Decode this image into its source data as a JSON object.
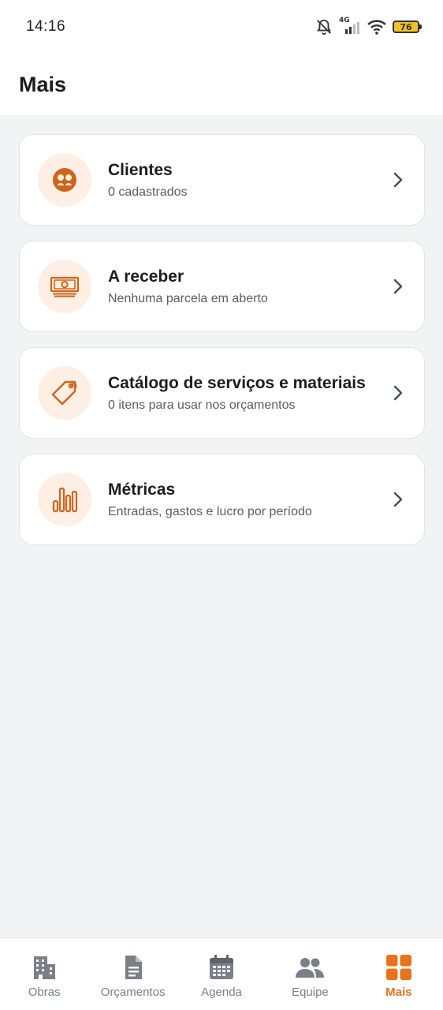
{
  "status_bar": {
    "time": "14:16",
    "network": "4G",
    "battery": "76"
  },
  "header": {
    "title": "Mais"
  },
  "menu": [
    {
      "title": "Clientes",
      "subtitle": "0 cadastrados",
      "icon": "clients-icon"
    },
    {
      "title": "A receber",
      "subtitle": "Nenhuma parcela em aberto",
      "icon": "money-icon"
    },
    {
      "title": "Catálogo de serviços e materiais",
      "subtitle": "0 itens para usar nos orçamentos",
      "icon": "tag-icon"
    },
    {
      "title": "Métricas",
      "subtitle": "Entradas, gastos e lucro por período",
      "icon": "bar-chart-icon"
    }
  ],
  "bottom_nav": [
    {
      "label": "Obras",
      "icon": "building-icon",
      "active": false
    },
    {
      "label": "Orçamentos",
      "icon": "document-icon",
      "active": false
    },
    {
      "label": "Agenda",
      "icon": "calendar-icon",
      "active": false
    },
    {
      "label": "Equipe",
      "icon": "team-icon",
      "active": false
    },
    {
      "label": "Mais",
      "icon": "grid-icon",
      "active": true
    }
  ],
  "colors": {
    "accent": "#e8731c",
    "icon_bg": "#fdefe3",
    "inactive": "#7a7f88"
  }
}
